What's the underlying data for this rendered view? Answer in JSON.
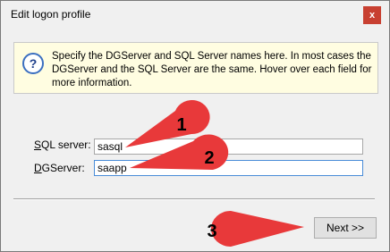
{
  "window": {
    "title": "Edit logon profile",
    "close_label": "x"
  },
  "info": {
    "icon": "question-mark-icon",
    "text": "Specify the DGServer and SQL Server names here.  In most cases the DGServer and the SQL Server are the same.  Hover over each field for more information."
  },
  "fields": {
    "sql_server": {
      "label_mnemonic": "S",
      "label_rest": "QL server:",
      "value": "sasql"
    },
    "dg_server": {
      "label_mnemonic": "D",
      "label_rest": "GServer:",
      "value": "saapp"
    }
  },
  "footer": {
    "next_label": "Next >>"
  },
  "callouts": [
    "1",
    "2",
    "3"
  ],
  "colors": {
    "callout_red": "#e8393a",
    "info_background": "#fffde1",
    "close_button": "#c84031"
  }
}
